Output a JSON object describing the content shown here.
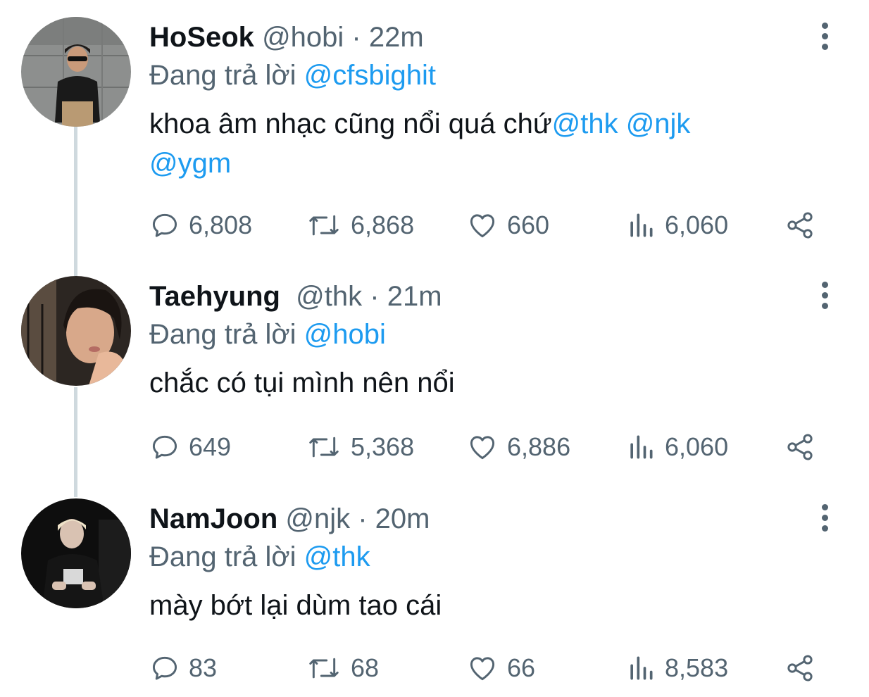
{
  "reply_prefix": "Đang trả lời",
  "tweets": [
    {
      "name": "HoSeok",
      "handle": "@hobi",
      "time": "· 22m",
      "reply_to": "@cfsbighit",
      "text": "khoa âm nhạc cũng nổi quá chứ",
      "mentions": "@thk @njk",
      "mentions2": "@ygm",
      "replies": "6,808",
      "retweets": "6,868",
      "likes": "660",
      "views": "6,060"
    },
    {
      "name": "Taehyung",
      "handle": "@thk",
      "time": "· 21m",
      "reply_to": "@hobi",
      "text": "chắc có tụi mình nên nổi",
      "replies": "649",
      "retweets": "5,368",
      "likes": "6,886",
      "views": "6,060"
    },
    {
      "name": "NamJoon",
      "handle": "@njk",
      "time": "· 20m",
      "reply_to": "@thk",
      "text": "mày bớt lại dùm tao cái",
      "replies": "83",
      "retweets": "68",
      "likes": "66",
      "views": "8,583"
    }
  ],
  "icons": {
    "reply": "speech-bubble-icon",
    "retweet": "retweet-arrows-icon",
    "like": "heart-icon",
    "views": "bar-chart-icon",
    "share": "share-nodes-icon",
    "more": "vertical-dots-icon"
  },
  "colors": {
    "link": "#1d9bf0",
    "muted": "#536471",
    "text": "#0f1419",
    "thread": "#cfd9de"
  }
}
